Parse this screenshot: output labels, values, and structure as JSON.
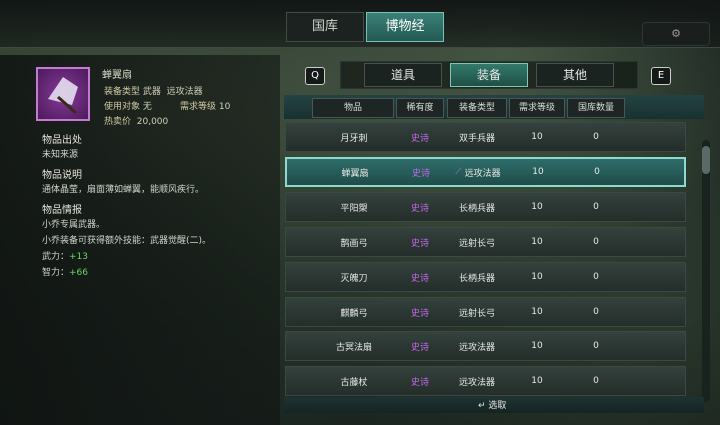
{
  "main_tabs": [
    {
      "label": "国库",
      "active": false
    },
    {
      "label": "博物经",
      "active": true
    }
  ],
  "top_right_label": "",
  "item": {
    "name": "蝉翼扇",
    "type_label": "装备类型",
    "type_value1": "武器",
    "type_value2": "远攻法器",
    "user_label": "使用对象",
    "user_value": "无",
    "req_label": "需求等级",
    "req_value": "10",
    "price_label": "热卖价",
    "price_value": "20,000",
    "source_title": "物品出处",
    "source_text": "未知来源",
    "desc_title": "物品说明",
    "desc_text": "通体晶莹，扇面薄如蝉翼，能顺风疾行。",
    "info_title": "物品情报",
    "info_lines": [
      "小乔专属武器。",
      "小乔装备可获得额外技能：武器觉醒(二)。"
    ],
    "stat1_label": "武力：",
    "stat1_value": "+13",
    "stat2_label": "智力：",
    "stat2_value": "+66"
  },
  "nav_left": "Q",
  "nav_right": "E",
  "sub_tabs": [
    {
      "label": "道具"
    },
    {
      "label": "装备"
    },
    {
      "label": "其他"
    }
  ],
  "headers": [
    "物品",
    "稀有度",
    "装备类型",
    "需求等级",
    "国库数量"
  ],
  "rows": [
    {
      "name": "月牙刺",
      "rarity": "史诗",
      "type": "双手兵器",
      "level": "10",
      "qty": "0",
      "selected": false,
      "wand": false
    },
    {
      "name": "蝉翼扇",
      "rarity": "史诗",
      "type": "远攻法器",
      "level": "10",
      "qty": "0",
      "selected": true,
      "wand": true
    },
    {
      "name": "平阳槊",
      "rarity": "史诗",
      "type": "长柄兵器",
      "level": "10",
      "qty": "0",
      "selected": false,
      "wand": false
    },
    {
      "name": "鹊画弓",
      "rarity": "史诗",
      "type": "远射长弓",
      "level": "10",
      "qty": "0",
      "selected": false,
      "wand": false
    },
    {
      "name": "灭魄刀",
      "rarity": "史诗",
      "type": "长柄兵器",
      "level": "10",
      "qty": "0",
      "selected": false,
      "wand": false
    },
    {
      "name": "麒麟弓",
      "rarity": "史诗",
      "type": "远射长弓",
      "level": "10",
      "qty": "0",
      "selected": false,
      "wand": false
    },
    {
      "name": "古冥法扇",
      "rarity": "史诗",
      "type": "远攻法器",
      "level": "10",
      "qty": "0",
      "selected": false,
      "wand": false
    },
    {
      "name": "古藤杖",
      "rarity": "史诗",
      "type": "远攻法器",
      "level": "10",
      "qty": "0",
      "selected": false,
      "wand": false
    }
  ],
  "confirm_label": "选取",
  "colors": {
    "rarity": "#c268e8",
    "accent": "#8fd8cf",
    "stat": "#69d469"
  }
}
